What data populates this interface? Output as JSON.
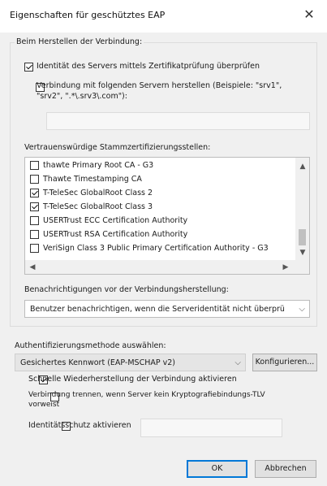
{
  "window": {
    "title": "Eigenschaften für geschütztes EAP",
    "close_glyph": "✕"
  },
  "connect_group": {
    "label": "Beim Herstellen der Verbindung:",
    "verify_identity": {
      "label": "Identität des Servers mittels Zertifikatprüfung überprüfen",
      "checked": true
    },
    "connect_servers": {
      "label_line1": "Verbindung mit folgenden Servern herstellen (Beispiele: \"srv1\",",
      "label_line2": "\"srv2\", \".*\\.srv3\\.com\"):",
      "checked": false
    },
    "servers_value": "",
    "trusted_ca_label": "Vertrauenswürdige Stammzertifizierungsstellen:",
    "ca_list": [
      {
        "name": "thawte Primary Root CA - G3",
        "checked": false
      },
      {
        "name": "Thawte Timestamping CA",
        "checked": false
      },
      {
        "name": "T-TeleSec GlobalRoot Class 2",
        "checked": true
      },
      {
        "name": "T-TeleSec GlobalRoot Class 3",
        "checked": true
      },
      {
        "name": "USERTrust ECC Certification Authority",
        "checked": false
      },
      {
        "name": "USERTrust RSA Certification Authority",
        "checked": false
      },
      {
        "name": "VeriSign Class 3 Public Primary Certification Authority - G3",
        "checked": false
      }
    ],
    "notify_label": "Benachrichtigungen vor der Verbindungsherstellung:",
    "notify_value": "Benutzer benachrichtigen, wenn die Serveridentität nicht überprü"
  },
  "auth": {
    "label": "Authentifizierungsmethode auswählen:",
    "method_value": "Gesichertes Kennwort (EAP-MSCHAP v2)",
    "configure_label": "Konfigurieren...",
    "fast_reconnect": {
      "label": "Schnelle Wiederherstellung der Verbindung aktivieren",
      "checked": true
    },
    "disconnect_tlv": {
      "label_line1": "Verbindung trennen, wenn Server kein Kryptografiebindungs-TLV",
      "label_line2": "vorweist",
      "checked": false
    },
    "identity_privacy": {
      "label": "Identitätsschutz aktivieren",
      "checked": false
    },
    "identity_value": ""
  },
  "buttons": {
    "ok": "OK",
    "cancel": "Abbrechen"
  },
  "glyphs": {
    "up": "▲",
    "down": "▼",
    "left": "◀",
    "right": "▶",
    "chevron": "⌵"
  }
}
